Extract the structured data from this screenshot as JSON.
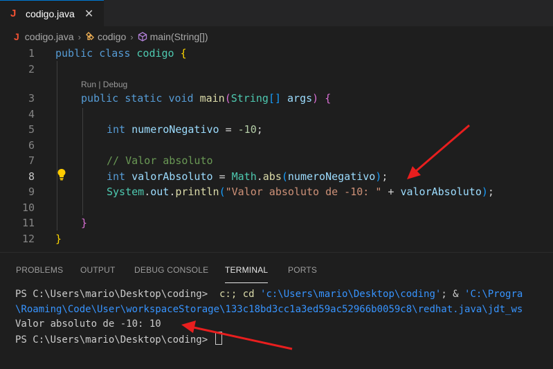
{
  "tab": {
    "icon_letter": "J",
    "label": "codigo.java",
    "close": "✕"
  },
  "breadcrumb": {
    "file_icon": "J",
    "file": "codigo.java",
    "class": "codigo",
    "method": "main(String[])"
  },
  "codelens": "Run | Debug",
  "line_numbers": [
    "1",
    "2",
    "3",
    "4",
    "5",
    "6",
    "7",
    "8",
    "9",
    "10",
    "11",
    "12"
  ],
  "code": {
    "l1": {
      "kw1": "public",
      "kw2": "class",
      "name": "codigo",
      "brace": "{"
    },
    "l3": {
      "kw1": "public",
      "kw2": "static",
      "kw3": "void",
      "fn": "main",
      "paren_open": "(",
      "type": "String",
      "arr": "[]",
      "arg": "args",
      "paren_close": ")",
      "brace": "{"
    },
    "l5": {
      "type": "int",
      "var": "numeroNegativo",
      "op": " = ",
      "num": "-10",
      "semi": ";"
    },
    "l7": {
      "comment": "// Valor absoluto"
    },
    "l8": {
      "type": "int",
      "var": "valorAbsoluto",
      "op": " = ",
      "cls": "Math",
      "dot": ".",
      "fn": "abs",
      "paren_open": "(",
      "arg": "numeroNegativo",
      "paren_close": ")",
      "semi": ";"
    },
    "l9": {
      "cls": "System",
      "dot1": ".",
      "field": "out",
      "dot2": ".",
      "fn": "println",
      "paren_open": "(",
      "str": "\"Valor absoluto de -10: \"",
      "plus": " + ",
      "arg": "valorAbsoluto",
      "paren_close": ")",
      "semi": ";"
    },
    "l11": {
      "brace": "}"
    },
    "l12": {
      "brace": "}"
    }
  },
  "panel": {
    "tabs": [
      "PROBLEMS",
      "OUTPUT",
      "DEBUG CONSOLE",
      "TERMINAL",
      "PORTS"
    ],
    "active_tab": "TERMINAL"
  },
  "terminal": {
    "line1_prompt": "PS C:\\Users\\mario\\Desktop\\coding> ",
    "line1_cmd": " c:; cd ",
    "line1_path1": "'c:\\Users\\mario\\Desktop\\coding'",
    "line1_amp": "; & ",
    "line1_path2": "'C:\\Progra",
    "line2": "\\Roaming\\Code\\User\\workspaceStorage\\133c18bd3cc1a3ed59ac52966b0059c8\\redhat.java\\jdt_ws",
    "line3": "Valor absoluto de -10: 10",
    "line4_prompt": "PS C:\\Users\\mario\\Desktop\\coding> "
  },
  "colors": {
    "accent": "#0078d4",
    "arrow": "#e81e1e",
    "java_icon": "#f05133"
  },
  "icons": {
    "bulb": "lightbulb-icon",
    "class": "symbol-class-icon",
    "method": "symbol-method-icon"
  }
}
